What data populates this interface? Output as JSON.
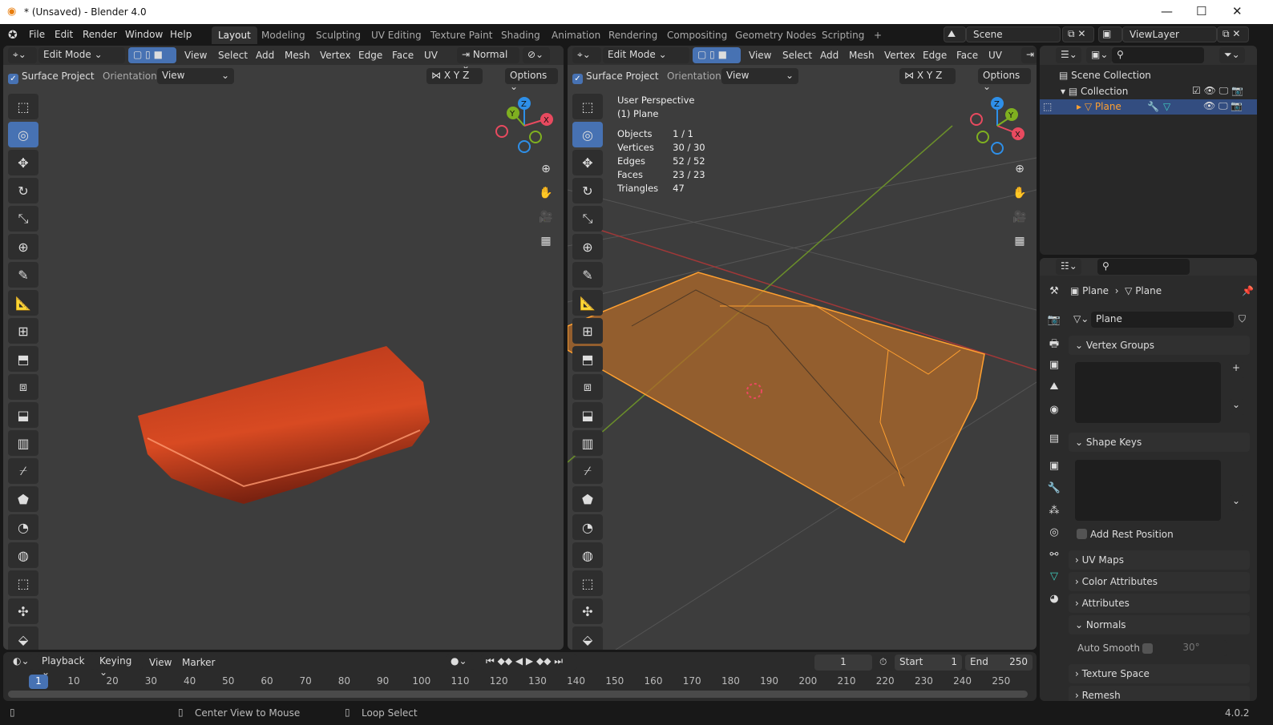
{
  "window": {
    "title": "* (Unsaved) - Blender 4.0",
    "minimize": "—",
    "maximize": "☐",
    "close": "✕"
  },
  "menu": [
    "File",
    "Edit",
    "Render",
    "Window",
    "Help"
  ],
  "workspaces": [
    {
      "label": "Layout",
      "active": true
    },
    {
      "label": "Modeling"
    },
    {
      "label": "Sculpting"
    },
    {
      "label": "UV Editing"
    },
    {
      "label": "Texture Paint"
    },
    {
      "label": "Shading"
    },
    {
      "label": "Animation"
    },
    {
      "label": "Rendering"
    },
    {
      "label": "Compositing"
    },
    {
      "label": "Geometry Nodes"
    },
    {
      "label": "Scripting"
    },
    {
      "label": "+"
    }
  ],
  "scene": {
    "name": "Scene",
    "view_layer": "ViewLayer"
  },
  "viewport": {
    "mode": "Edit Mode",
    "menus": [
      "View",
      "Select",
      "Add",
      "Mesh",
      "Vertex",
      "Edge",
      "Face",
      "UV"
    ],
    "transform_orientation": "Normal",
    "surface_project": "Surface Project",
    "orientation_label": "Orientation:",
    "orientation_value": "View",
    "axes": [
      "X",
      "Y",
      "Z"
    ],
    "options": "Options"
  },
  "overlay": {
    "perspective": "User Perspective",
    "object": "(1) Plane",
    "stats": [
      {
        "label": "Objects",
        "value": "1 / 1"
      },
      {
        "label": "Vertices",
        "value": "30 / 30"
      },
      {
        "label": "Edges",
        "value": "52 / 52"
      },
      {
        "label": "Faces",
        "value": "23 / 23"
      },
      {
        "label": "Triangles",
        "value": "47"
      }
    ]
  },
  "gizmo": {
    "x": "X",
    "y": "Y",
    "z": "Z",
    "colors": {
      "x": "#e84a5f",
      "y": "#7fb020",
      "z": "#2e8fe8"
    }
  },
  "tools": [
    "select-box-icon",
    "cursor-icon",
    "move-icon",
    "rotate-icon",
    "scale-icon",
    "transform-icon",
    "annotate-icon",
    "measure-icon",
    "add-cube-icon",
    "extrude-icon",
    "inset-icon",
    "bevel-icon",
    "loop-cut-icon",
    "knife-icon",
    "poly-build-icon",
    "spin-icon",
    "smooth-icon",
    "edge-slide-icon",
    "shrink-fatten-icon",
    "shear-icon"
  ],
  "outliner": {
    "scene_collection": "Scene Collection",
    "collection": "Collection",
    "object": "Plane"
  },
  "properties": {
    "breadcrumb_object": "Plane",
    "breadcrumb_data": "Plane",
    "mesh_name": "Plane",
    "panels": {
      "vertex_groups": "Vertex Groups",
      "shape_keys": "Shape Keys",
      "add_rest_position": "Add Rest Position",
      "uv_maps": "UV Maps",
      "color_attributes": "Color Attributes",
      "attributes": "Attributes",
      "normals": "Normals",
      "auto_smooth": "Auto Smooth",
      "auto_smooth_angle": "30°",
      "texture_space": "Texture Space",
      "remesh": "Remesh"
    }
  },
  "timeline": {
    "menus": [
      "Playback",
      "Keying",
      "View",
      "Marker"
    ],
    "current_frame": "1",
    "start_label": "Start",
    "start": "1",
    "end_label": "End",
    "end": "250",
    "ticks": [
      "10",
      "20",
      "30",
      "40",
      "50",
      "60",
      "70",
      "80",
      "90",
      "100",
      "110",
      "120",
      "130",
      "140",
      "150",
      "160",
      "170",
      "180",
      "190",
      "200",
      "210",
      "220",
      "230",
      "240",
      "250"
    ]
  },
  "status": {
    "hint1": "Center View to Mouse",
    "hint2": "Loop Select",
    "version": "4.0.2"
  },
  "colors": {
    "accent": "#4772b3",
    "selection": "#ffa030",
    "mesh_red": "#c8401e"
  }
}
